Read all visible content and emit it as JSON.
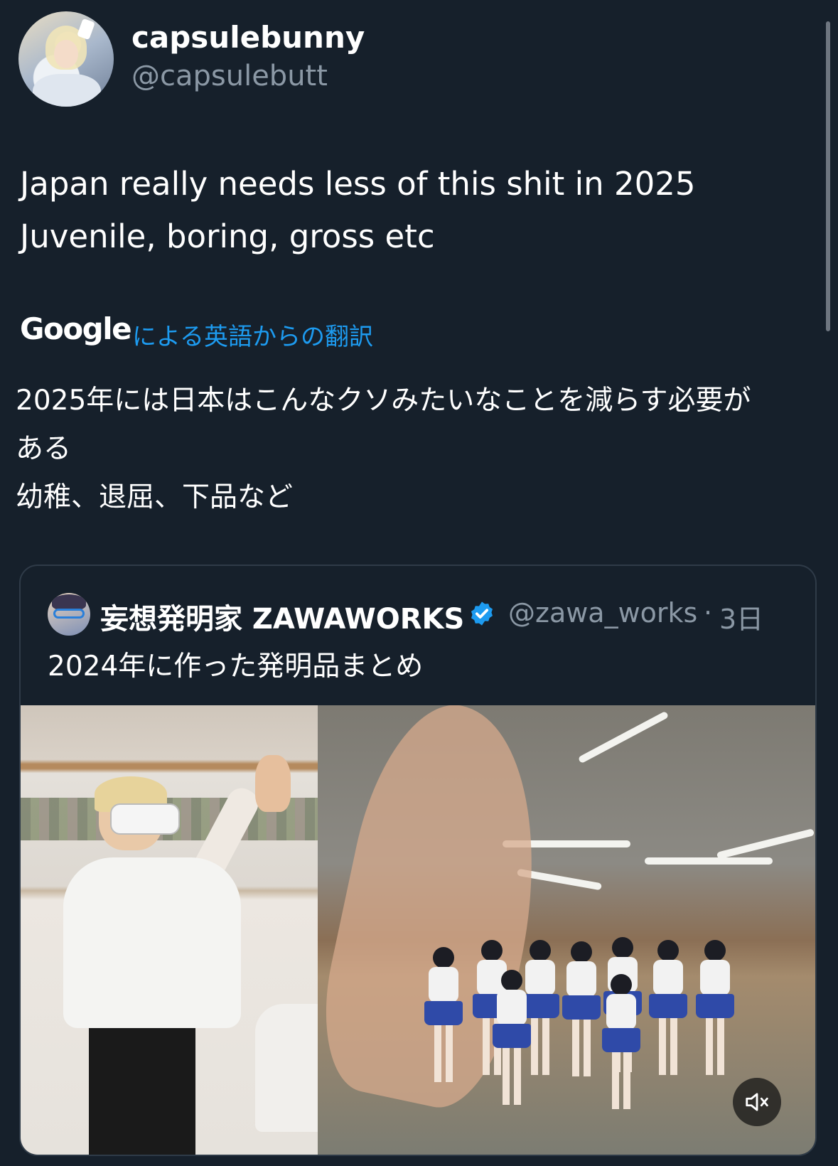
{
  "author": {
    "display_name": "capsulebunny",
    "handle": "@capsulebutt"
  },
  "tweet": {
    "lines": [
      "Japan really needs less of this shit in 2025",
      "Juvenile, boring, gross etc"
    ]
  },
  "translation": {
    "provider": "Google",
    "label": "による英語からの翻訳",
    "lines": [
      "2025年には日本はこんなクソみたいなことを減らす必要が",
      "ある",
      "幼稚、退屈、下品など"
    ]
  },
  "quoted_tweet": {
    "display_name": "妄想発明家 ZAWAWORKS",
    "handle": "@zawa_works",
    "separator": "·",
    "time": "3日",
    "text": "2024年に作った発明品まとめ",
    "verified_color": "#1d9bf0"
  },
  "icons": {
    "verified": "verified-badge-icon",
    "mute": "speaker-muted-icon"
  },
  "colors": {
    "background": "#16202b",
    "link": "#1d9bf0",
    "secondary_text": "#8b98a5"
  }
}
